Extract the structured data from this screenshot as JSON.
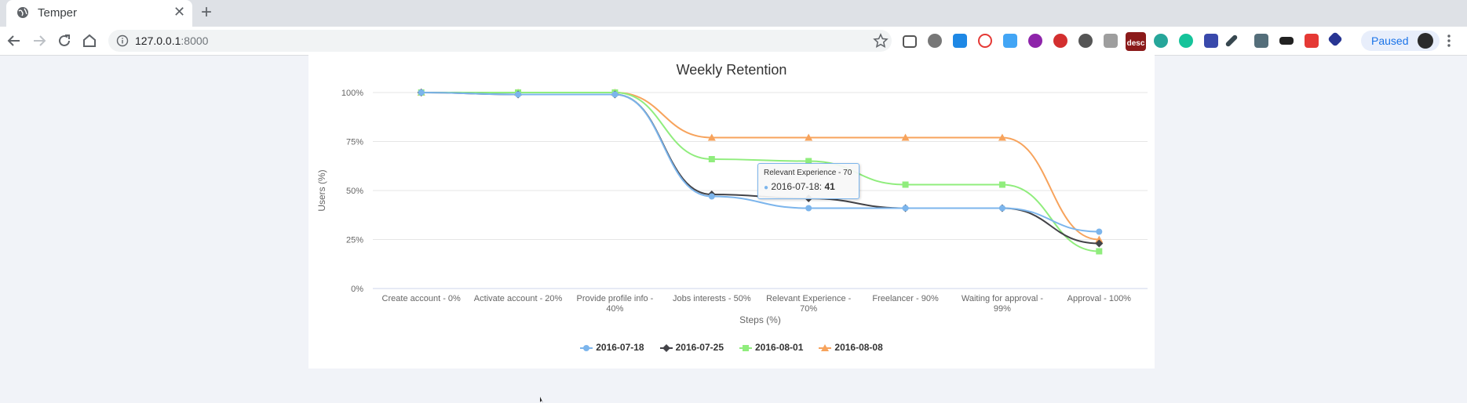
{
  "browser": {
    "tab_title": "Temper",
    "url_host": "127.0.0.1",
    "url_port": ":8000",
    "profile_status": "Paused",
    "extension_badge": "desc"
  },
  "colors": {
    "s1": "#7cb5ec",
    "s2": "#434348",
    "s3": "#90ed7d",
    "s4": "#f7a35c"
  },
  "chart_data": {
    "type": "line",
    "title": "Weekly Retention",
    "xlabel": "Steps (%)",
    "ylabel": "Users (%)",
    "ylim": [
      0,
      100
    ],
    "yticks": [
      "0%",
      "25%",
      "50%",
      "75%",
      "100%"
    ],
    "grid": true,
    "legend_position": "bottom",
    "categories": [
      [
        "Create account - 0%"
      ],
      [
        "Activate account - 20%"
      ],
      [
        "Provide profile info -",
        "40%"
      ],
      [
        "Jobs interests - 50%"
      ],
      [
        "Relevant Experience -",
        "70%"
      ],
      [
        "Freelancer - 90%"
      ],
      [
        "Waiting for approval -",
        "99%"
      ],
      [
        "Approval - 100%"
      ]
    ],
    "series": [
      {
        "name": "2016-07-18",
        "marker": "circle",
        "values": [
          100,
          99,
          99,
          47,
          41,
          41,
          41,
          29
        ]
      },
      {
        "name": "2016-07-25",
        "marker": "diamond",
        "values": [
          100,
          99,
          99,
          48,
          46,
          41,
          41,
          23
        ]
      },
      {
        "name": "2016-08-01",
        "marker": "square",
        "values": [
          100,
          100,
          100,
          66,
          65,
          53,
          53,
          19
        ]
      },
      {
        "name": "2016-08-08",
        "marker": "triangle",
        "values": [
          100,
          100,
          100,
          77,
          77,
          77,
          77,
          25
        ]
      }
    ]
  },
  "tooltip": {
    "header": "Relevant Experience - 70",
    "series": "2016-07-18",
    "sep": ": ",
    "value": "41"
  }
}
